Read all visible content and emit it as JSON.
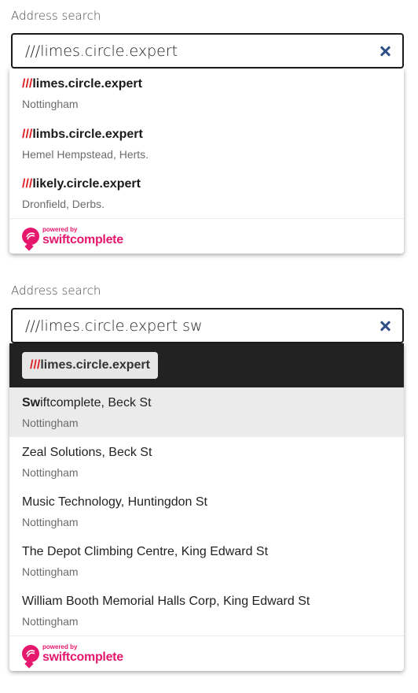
{
  "widget1": {
    "label": "Address search",
    "input_value": "///limes.circle.expert",
    "results": [
      {
        "slashes": "///",
        "words": "limes.circle.expert",
        "location": "Nottingham"
      },
      {
        "slashes": "///",
        "words": "limbs.circle.expert",
        "location": "Hemel Hempstead, Herts."
      },
      {
        "slashes": "///",
        "words": "likely.circle.expert",
        "location": "Dronfield, Derbs."
      }
    ],
    "footer": {
      "small": "powered by",
      "big": "swiftcomplete"
    }
  },
  "widget2": {
    "label": "Address search",
    "input_value": "///limes.circle.expert sw",
    "selected_chip": {
      "slashes": "///",
      "words": "limes.circle.expert"
    },
    "results": [
      {
        "match": "Sw",
        "rest": "iftcomplete, Beck St",
        "location": "Nottingham"
      },
      {
        "match": "",
        "rest": "Zeal Solutions, Beck St",
        "location": "Nottingham"
      },
      {
        "match": "",
        "rest": "Music Technology, Huntingdon St",
        "location": "Nottingham"
      },
      {
        "match": "",
        "rest": "The Depot Climbing Centre, King Edward St",
        "location": "Nottingham"
      },
      {
        "match": "",
        "rest": "William Booth Memorial Halls Corp, King Edward St",
        "location": "Nottingham"
      }
    ],
    "footer": {
      "small": "powered by",
      "big": "swiftcomplete"
    }
  },
  "colors": {
    "accent_red": "#e11f26",
    "brand_pink": "#e5186e",
    "clear_icon": "#2e4f86"
  },
  "icons": {
    "clear": "close-icon",
    "logo": "swiftcomplete-logo-icon"
  }
}
